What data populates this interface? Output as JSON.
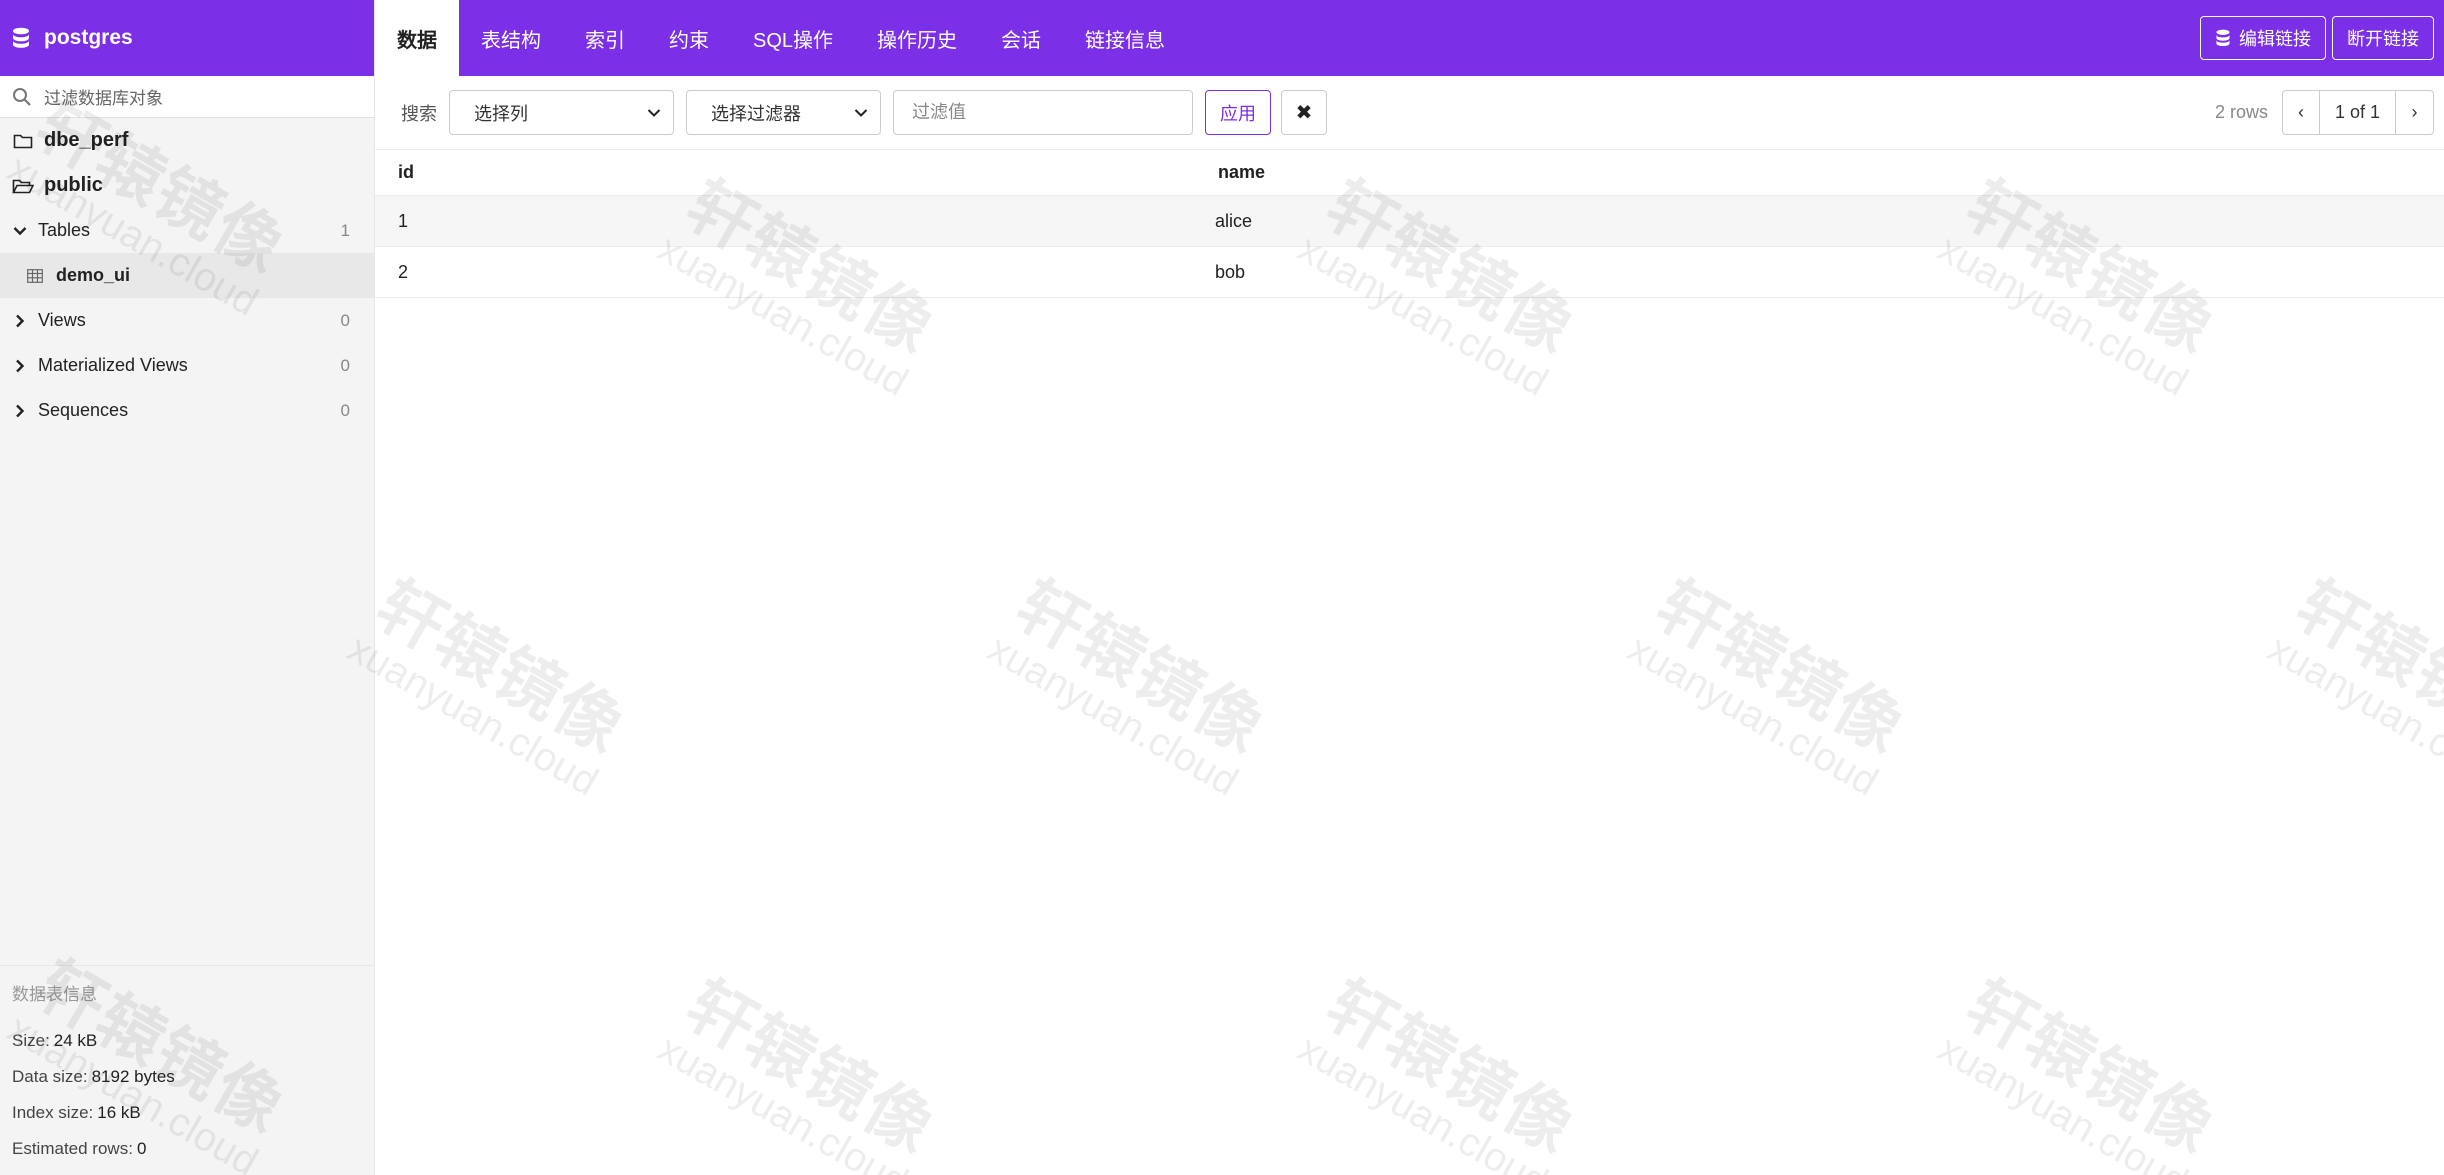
{
  "sidebar": {
    "db_name": "postgres",
    "search_placeholder": "过滤数据库对象",
    "schemas": [
      {
        "name": "dbe_perf",
        "icon": "folder-icon"
      },
      {
        "name": "public",
        "icon": "folder-open-icon"
      }
    ],
    "groups": [
      {
        "label": "Tables",
        "count": "1",
        "expanded": true,
        "items": [
          "demo_ui"
        ]
      },
      {
        "label": "Views",
        "count": "0",
        "expanded": false
      },
      {
        "label": "Materialized Views",
        "count": "0",
        "expanded": false
      },
      {
        "label": "Sequences",
        "count": "0",
        "expanded": false
      }
    ],
    "info": {
      "title": "数据表信息",
      "size_label": "Size:",
      "size_value": "24 kB",
      "data_size_label": "Data size:",
      "data_size_value": "8192 bytes",
      "index_size_label": "Index size:",
      "index_size_value": "16 kB",
      "est_rows_label": "Estimated rows:",
      "est_rows_value": "0"
    }
  },
  "tabs": [
    "数据",
    "表结构",
    "索引",
    "约束",
    "SQL操作",
    "操作历史",
    "会话",
    "链接信息"
  ],
  "active_tab": "数据",
  "top_actions": {
    "edit": "编辑链接",
    "disconnect": "断开链接"
  },
  "filter": {
    "label": "搜索",
    "column_select": "选择列",
    "filter_select": "选择过滤器",
    "value_placeholder": "过滤值",
    "apply": "应用",
    "clear": "✖"
  },
  "pagination": {
    "rows": "2 rows",
    "page": "1 of 1",
    "prev": "‹",
    "next": "›"
  },
  "table": {
    "columns": [
      "id",
      "name"
    ],
    "rows": [
      [
        "1",
        "alice"
      ],
      [
        "2",
        "bob"
      ]
    ]
  },
  "watermark": {
    "cn": "轩辕镜像",
    "en": "xuanyuan.cloud"
  },
  "colors": {
    "brand": "#7b2fe6"
  }
}
